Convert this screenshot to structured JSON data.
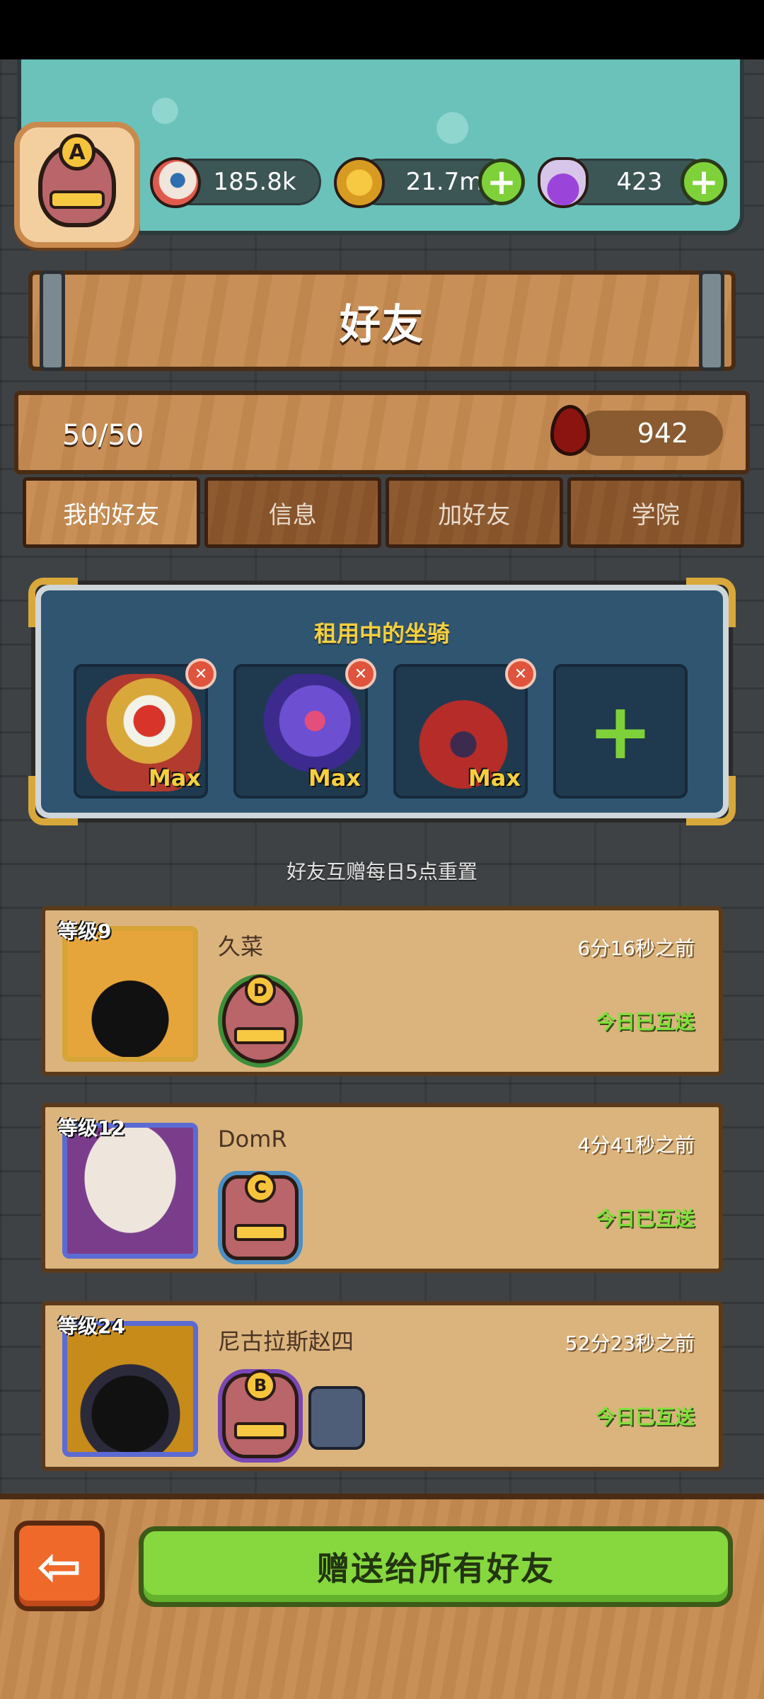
{
  "resources": {
    "eyeballs": "185.8k",
    "coins": "21.7m",
    "potions": "423",
    "plus_symbol": "+"
  },
  "player": {
    "rank_letter": "A"
  },
  "title": "好友",
  "stats": {
    "friend_count": "50/50",
    "blood_amount": "942"
  },
  "tabs": [
    {
      "label": "我的好友",
      "active": true
    },
    {
      "label": "信息",
      "active": false
    },
    {
      "label": "加好友",
      "active": false
    },
    {
      "label": "学院",
      "active": false
    }
  ],
  "mounts": {
    "title": "租用中的坐骑",
    "slots": [
      {
        "level": "Max",
        "remove_symbol": "✕"
      },
      {
        "level": "Max",
        "remove_symbol": "✕"
      },
      {
        "level": "Max",
        "remove_symbol": "✕"
      }
    ],
    "add_symbol": "+"
  },
  "reset_note": "好友互赠每日5点重置",
  "friends": [
    {
      "level": "等级9",
      "name": "久菜",
      "time": "6分16秒之前",
      "status": "今日已互送",
      "rank_letter": "D",
      "badge_color": "#3f8f3a"
    },
    {
      "level": "等级12",
      "name": "DomR",
      "time": "4分41秒之前",
      "status": "今日已互送",
      "rank_letter": "C",
      "badge_color": "#4b8fc4"
    },
    {
      "level": "等级24",
      "name": "尼古拉斯赵四",
      "time": "52分23秒之前",
      "status": "今日已互送",
      "rank_letter": "B",
      "badge_color": "#7a47b5"
    }
  ],
  "bottom": {
    "back_symbol": "⇦",
    "gift_all_label": "赠送给所有好友"
  },
  "colors": {
    "accent_green": "#86d83e",
    "sent_green": "#7fe03a",
    "gold": "#f6cf3e"
  }
}
